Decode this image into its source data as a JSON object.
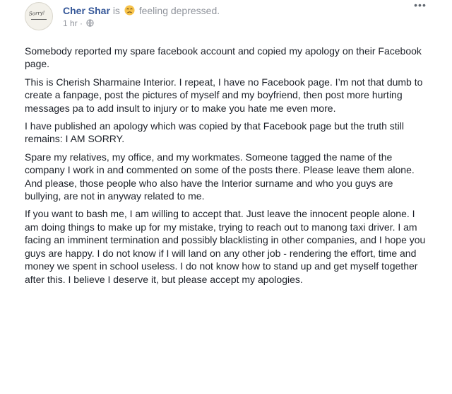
{
  "post": {
    "author": "Cher Shar",
    "is_word": "is",
    "feeling": "feeling depressed.",
    "feeling_icon": "sad-face-emoji",
    "timestamp": "1 hr",
    "separator": "·",
    "privacy_icon": "globe-icon",
    "avatar_text": "Sorry!",
    "more_icon": "more-options-icon",
    "more_label": "•••",
    "paragraphs": [
      "Somebody reported my spare facebook account and copied my apology on their Facebook page.",
      "This is Cherish Sharmaine Interior. I repeat, I have no Facebook page. I’m not that dumb to create a fanpage, post the pictures of myself and my boyfriend, then post more hurting messages pa to add insult to injury or to make you hate me even more.",
      "I have published an apology which was copied by that Facebook page but the truth still remains: I AM SORRY.",
      "Spare my relatives, my office, and my workmates. Someone tagged the name of the company I work in and commented on some of the posts there. Please leave them alone. And please, those people who also have the Interior surname and who you guys are bullying, are not in anyway related to me.",
      "If you want to bash me, I am willing to accept that. Just leave the innocent people alone. I am doing things to make up for my mistake, trying to reach out to manong taxi driver. I am facing an imminent termination and possibly blacklisting in other companies, and I hope you guys are happy. I do not know if I will land on any other job - rendering the effort, time and money we spent in school useless. I do not know how to stand up and get myself together after this. I believe I deserve it, but please accept my apologies."
    ]
  },
  "colors": {
    "author": "#365899",
    "muted": "#90949c",
    "text": "#1d2129",
    "emoji": "#f7c34a"
  }
}
